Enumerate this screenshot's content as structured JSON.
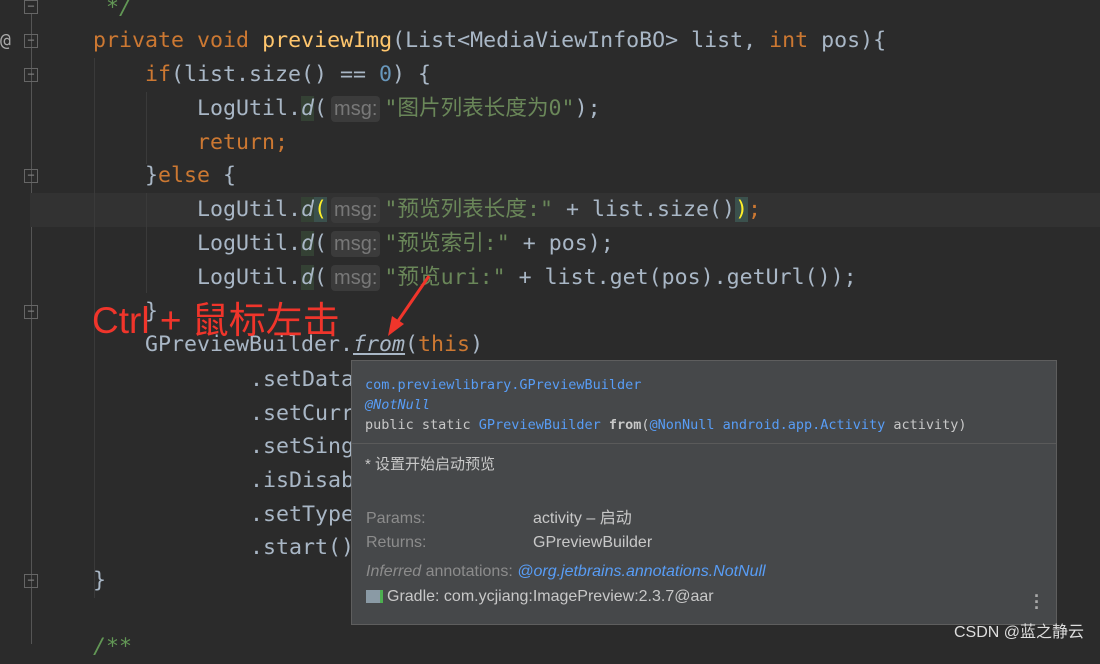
{
  "code": {
    "comment_end": "*/",
    "method_signature": {
      "modifier1": "private",
      "modifier2": "void",
      "name": "previewImg",
      "params": "(List<MediaViewInfoBO> list, ",
      "type_int": "int",
      "rest": " pos){"
    },
    "if_kw": "if",
    "if_rest": "(list.size() == ",
    "zero": "0",
    "if_end": ") {",
    "log_class": "LogUtil.",
    "log_method": "d",
    "hint_label": "msg:",
    "log1_str": "\"图片列表长度为0\"",
    "log1_end": ");",
    "return_kw": "return",
    "semicolon": ";",
    "else_open": "}",
    "else_kw": "else",
    "else_brace": " {",
    "log2_str": "\"预览列表长度:\"",
    "log2_rest": " + list.size()",
    "log2_end": ";",
    "log3_str": "\"预览索引:\"",
    "log3_rest": " + pos);",
    "log4_str": "\"预览uri:\"",
    "log4_rest": " + list.get(pos).getUrl());",
    "close_brace": "}",
    "builder": "GPreviewBuilder.",
    "from": "from",
    "this_open": "(",
    "this_kw": "this",
    "this_close": ")",
    "chain": [
      ".setData",
      ".setCurr",
      ".setSing",
      ".isDisab",
      ".setType",
      ".start()"
    ],
    "method_close": "}",
    "doc_start": "/**"
  },
  "annotation": {
    "text": "Ctrl + 鼠标左击",
    "color": "#f0352b"
  },
  "popup": {
    "qualified": "com.previewlibrary.GPreviewBuilder",
    "annotation": "@NotNull",
    "sig_prefix": "public static ",
    "sig_type": "GPreviewBuilder",
    "sig_space": " ",
    "sig_method": "from",
    "sig_paren": "(",
    "sig_ann": "@NonNull",
    "sig_param_type": " android.app.Activity",
    "sig_param": " activity)",
    "description": "* 设置开始启动预览",
    "params_label": "Params:",
    "params_value": "activity – 启动",
    "returns_label": "Returns:",
    "returns_value": "GPreviewBuilder",
    "inferred_label_it": "Inferred",
    "inferred_label": " annotations:",
    "inferred_value": "@org.jetbrains.annotations.NotNull",
    "gradle": "Gradle: com.ycjiang:ImagePreview:2.3.7@aar",
    "more_icon": "vertical-ellipsis"
  },
  "watermark": "CSDN @蓝之静云"
}
